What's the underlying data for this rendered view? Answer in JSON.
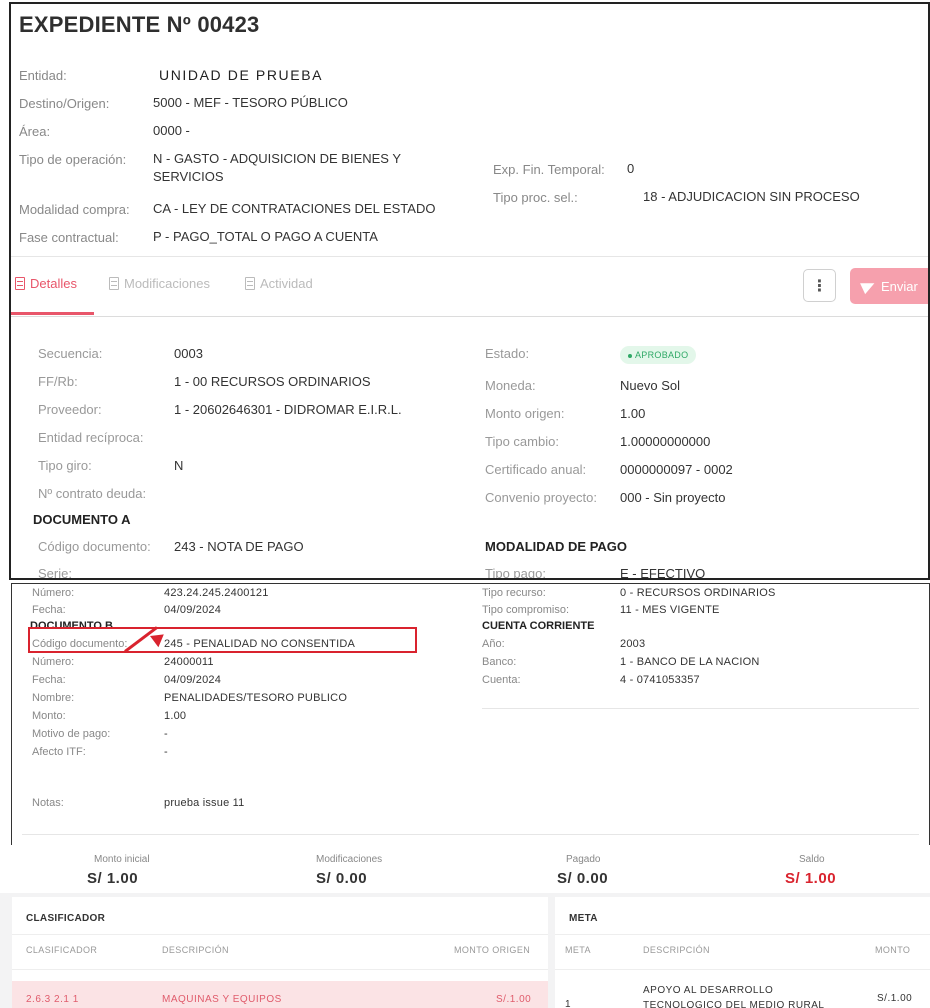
{
  "header": {
    "title": "EXPEDIENTE Nº 00423",
    "fields": {
      "entidad_label": "Entidad:",
      "entidad_value": "UNIDAD DE PRUEBA",
      "destino_label": "Destino/Origen:",
      "destino_value": "5000 - MEF - TESORO PÚBLICO",
      "area_label": "Área:",
      "area_value": "0000 -",
      "tipo_op_label": "Tipo de operación:",
      "tipo_op_value": "N - GASTO - ADQUISICION DE BIENES Y SERVICIOS",
      "modalidad_label": "Modalidad compra:",
      "modalidad_value": "CA - LEY DE CONTRATACIONES DEL ESTADO",
      "fase_label": "Fase contractual:",
      "fase_value": "P - PAGO_TOTAL O PAGO A CUENTA",
      "exp_fin_label": "Exp. Fin. Temporal:",
      "exp_fin_value": "0",
      "tipo_proc_label": "Tipo proc. sel.:",
      "tipo_proc_value": "18 - ADJUDICACION SIN PROCESO"
    }
  },
  "tabs": [
    {
      "label": "Detalles",
      "active": true
    },
    {
      "label": "Modificaciones",
      "active": false
    },
    {
      "label": "Actividad",
      "active": false
    }
  ],
  "actions": {
    "more_label": "⋮",
    "send_label": "Enviar"
  },
  "details": {
    "secuencia_label": "Secuencia:",
    "secuencia_value": "0003",
    "ffrb_label": "FF/Rb:",
    "ffrb_value": "1 - 00 RECURSOS ORDINARIOS",
    "proveedor_label": "Proveedor:",
    "proveedor_value": "1 - 20602646301 - DIDROMAR E.I.R.L.",
    "entidad_reciproca_label": "Entidad recíproca:",
    "tipo_giro_label": "Tipo giro:",
    "tipo_giro_value": "N",
    "contrato_label": "Nº contrato deuda:",
    "estado_label": "Estado:",
    "estado_value": "APROBADO",
    "moneda_label": "Moneda:",
    "moneda_value": "Nuevo Sol",
    "monto_origen_label": "Monto origen:",
    "monto_origen_value": "1.00",
    "tipo_cambio_label": "Tipo cambio:",
    "tipo_cambio_value": "1.00000000000",
    "certificado_label": "Certificado anual:",
    "certificado_value": "0000000097 - 0002",
    "convenio_label": "Convenio proyecto:",
    "convenio_value": "000 - Sin proyecto",
    "doc_a_title": "DOCUMENTO A",
    "codigo_doc_label": "Código documento:",
    "codigo_doc_value": "243 - NOTA DE PAGO",
    "serie_label": "Serie:",
    "modalidad_pago_title": "MODALIDAD DE PAGO",
    "tipo_pago_label": "Tipo pago:",
    "tipo_pago_value": "E - EFECTIVO"
  },
  "lower": {
    "numero_a_label": "Número:",
    "numero_a_value": "423.24.245.2400121",
    "fecha_a_label": "Fecha:",
    "fecha_a_value": "04/09/2024",
    "tipo_recurso_label": "Tipo recurso:",
    "tipo_recurso_value": "0 - RECURSOS ORDINARIOS",
    "tipo_compromiso_label": "Tipo compromiso:",
    "tipo_compromiso_value": "11 - MES VIGENTE",
    "doc_b_title": "DOCUMENTO B",
    "cuenta_title": "CUENTA CORRIENTE",
    "codigo_doc_b_label": "Código documento:",
    "codigo_doc_b_value": "245 - PENALIDAD NO CONSENTIDA",
    "anio_label": "Año:",
    "anio_value": "2003",
    "numero_b_label": "Número:",
    "numero_b_value": "24000011",
    "banco_label": "Banco:",
    "banco_value": "1 - BANCO DE LA NACION",
    "fecha_b_label": "Fecha:",
    "fecha_b_value": "04/09/2024",
    "cuenta_label": "Cuenta:",
    "cuenta_value": "4 - 0741053357",
    "nombre_label": "Nombre:",
    "nombre_value": "PENALIDADES/TESORO PUBLICO",
    "monto_label": "Monto:",
    "monto_value": "1.00",
    "motivo_label": "Motivo de pago:",
    "motivo_value": "-",
    "afecto_label": "Afecto ITF:",
    "afecto_value": "-",
    "notas_label": "Notas:",
    "notas_value": "prueba issue 11"
  },
  "summary": {
    "monto_inicial_label": "Monto inicial",
    "monto_inicial_value": "S/ 1.00",
    "modificaciones_label": "Modificaciones",
    "modificaciones_value": "S/ 0.00",
    "pagado_label": "Pagado",
    "pagado_value": "S/ 0.00",
    "saldo_label": "Saldo",
    "saldo_value": "S/ 1.00"
  },
  "clasificador_table": {
    "title": "CLASIFICADOR",
    "columns": [
      "CLASIFICADOR",
      "DESCRIPCIÓN",
      "MONTO ORIGEN"
    ],
    "rows": [
      {
        "clasificador": "2.6.3 2.1 1",
        "descripcion": "MAQUINAS Y EQUIPOS",
        "monto": "S/.1.00"
      }
    ]
  },
  "meta_table": {
    "title": "META",
    "columns": [
      "META",
      "DESCRIPCIÓN",
      "MONTO"
    ],
    "rows": [
      {
        "meta": "1",
        "descripcion_line1": "APOYO AL DESARROLLO",
        "descripcion_line2": "TECNOLOGICO DEL MEDIO RURAL",
        "monto": "S/.1.00"
      }
    ]
  },
  "colors": {
    "accent": "#e8566a",
    "send_button": "#f6a0ad",
    "highlight": "#d9232e",
    "status_green": "#2fa866",
    "row_highlight": "#fbe3e5"
  }
}
